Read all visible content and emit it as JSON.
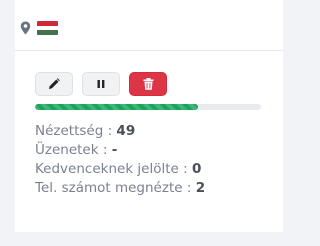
{
  "location": {
    "icon": "map-pin-icon",
    "flag": "hungary-flag",
    "flag_colors": [
      "#ce2939",
      "#ffffff",
      "#477050"
    ]
  },
  "actions": [
    {
      "name": "edit",
      "icon": "pencil-icon"
    },
    {
      "name": "pause",
      "icon": "pause-icon"
    },
    {
      "name": "delete",
      "icon": "trash-icon",
      "color": "#dc3545"
    }
  ],
  "progress": {
    "percent": 72,
    "color": "#17a55a"
  },
  "stats": [
    {
      "label": "Nézettség : ",
      "value": "49"
    },
    {
      "label": "Üzenetek : ",
      "value": "-"
    },
    {
      "label": "Kedvenceknek jelölte : ",
      "value": "0"
    },
    {
      "label": "Tel. számot megnézte : ",
      "value": "2"
    }
  ]
}
